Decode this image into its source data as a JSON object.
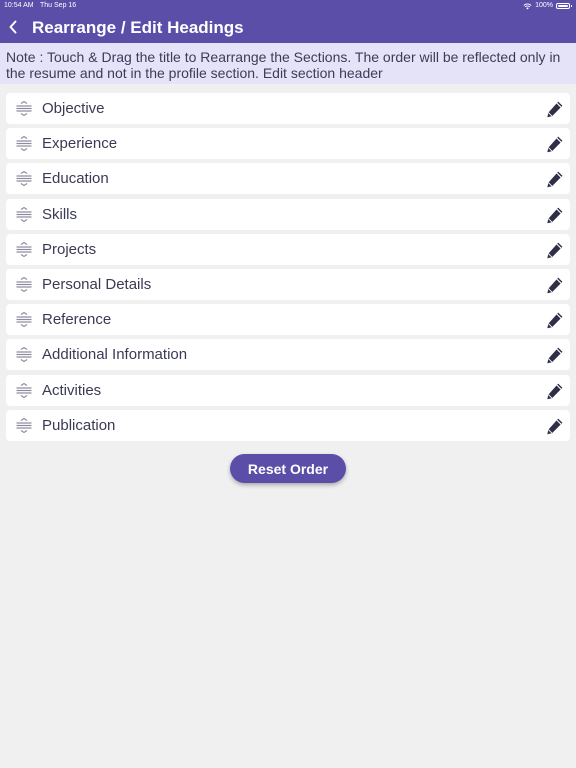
{
  "status_bar": {
    "time": "10:54 AM",
    "date": "Thu Sep 16",
    "battery": "100%"
  },
  "header": {
    "title": "Rearrange / Edit Headings",
    "back_icon": "chevron-left-icon"
  },
  "note": "Note : Touch & Drag the title to Rearrange the Sections. The order will be reflected only in the resume and not in the profile section. Edit section header",
  "sections": [
    {
      "label": "Objective"
    },
    {
      "label": "Experience"
    },
    {
      "label": "Education"
    },
    {
      "label": "Skills"
    },
    {
      "label": "Projects"
    },
    {
      "label": "Personal Details"
    },
    {
      "label": "Reference"
    },
    {
      "label": "Additional Information"
    },
    {
      "label": "Activities"
    },
    {
      "label": "Publication"
    }
  ],
  "reset_button": "Reset Order",
  "colors": {
    "accent": "#5a4ea8",
    "note_background": "#e5e3f8",
    "page_background": "#f0f0f0",
    "pencil": "#2e2e48"
  }
}
